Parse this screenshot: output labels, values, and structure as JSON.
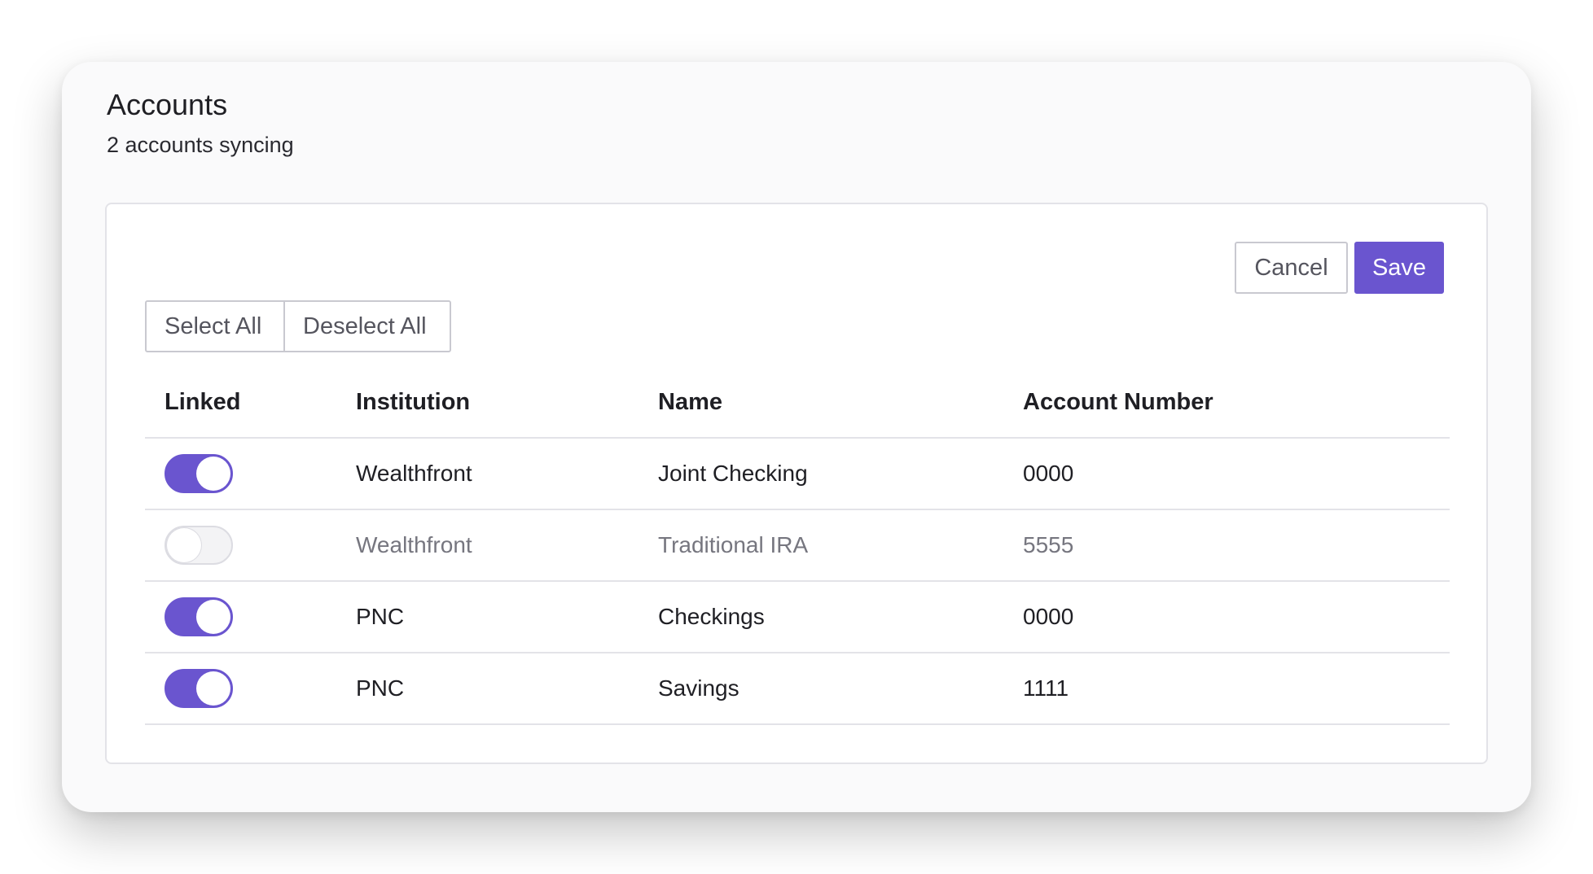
{
  "header": {
    "title": "Accounts",
    "subtitle": "2 accounts syncing"
  },
  "actions": {
    "cancel_label": "Cancel",
    "save_label": "Save",
    "select_all_label": "Select All",
    "deselect_all_label": "Deselect All"
  },
  "table": {
    "columns": [
      "Linked",
      "Institution",
      "Name",
      "Account Number"
    ],
    "rows": [
      {
        "linked": true,
        "institution": "Wealthfront",
        "name": "Joint Checking",
        "account_number": "0000"
      },
      {
        "linked": false,
        "institution": "Wealthfront",
        "name": "Traditional IRA",
        "account_number": "5555"
      },
      {
        "linked": true,
        "institution": "PNC",
        "name": "Checkings",
        "account_number": "0000"
      },
      {
        "linked": true,
        "institution": "PNC",
        "name": "Savings",
        "account_number": "1111"
      }
    ]
  },
  "colors": {
    "accent": "#6a55cf",
    "toggle_off_bg": "#f3f3f5",
    "border": "#e3e3e8"
  }
}
